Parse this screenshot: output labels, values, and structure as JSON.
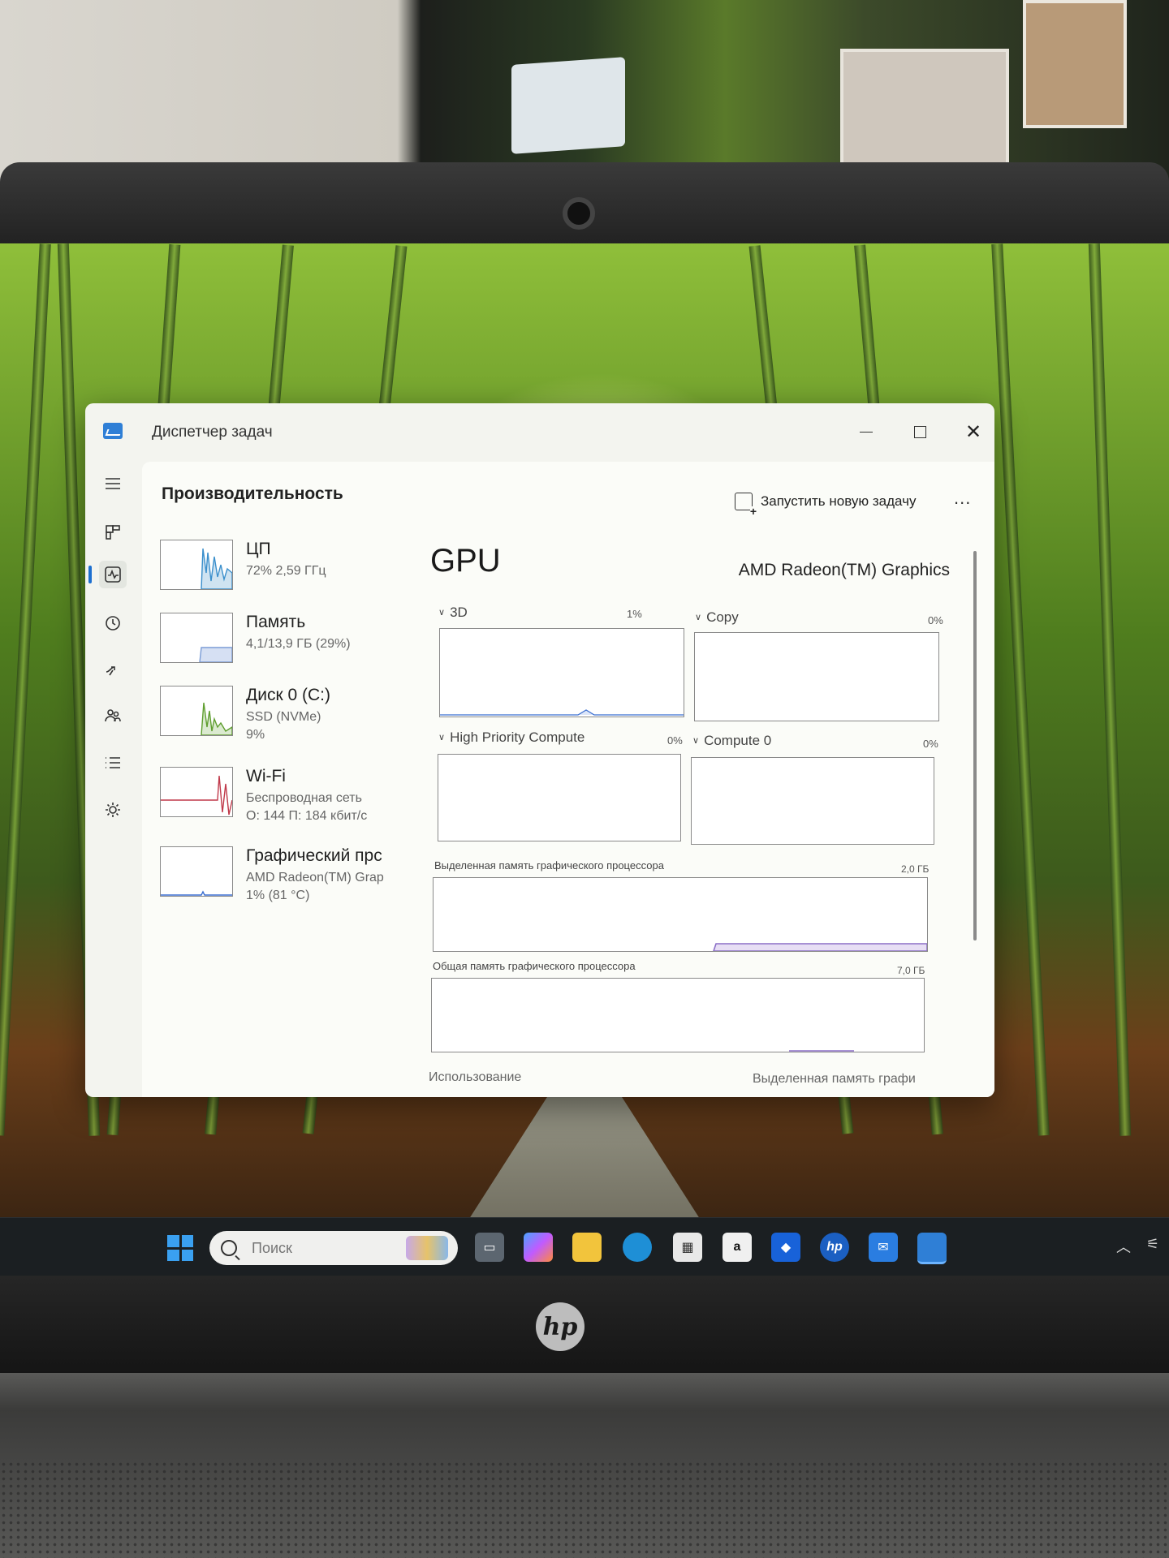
{
  "window": {
    "title": "Диспетчер задач",
    "page_title": "Производительность",
    "run_new_task": "Запустить новую задачу",
    "more": "..."
  },
  "sidebar": {
    "items": [
      {
        "name": "hamburger",
        "icon": "menu-icon"
      },
      {
        "name": "processes",
        "icon": "processes-icon"
      },
      {
        "name": "performance",
        "icon": "performance-icon",
        "active": true
      },
      {
        "name": "app-history",
        "icon": "history-icon"
      },
      {
        "name": "startup",
        "icon": "startup-icon"
      },
      {
        "name": "users",
        "icon": "users-icon"
      },
      {
        "name": "details",
        "icon": "details-icon"
      },
      {
        "name": "services",
        "icon": "services-icon"
      },
      {
        "name": "settings",
        "icon": "settings-icon"
      }
    ]
  },
  "devices": [
    {
      "name": "ЦП",
      "line1": "72% 2,59 ГГц",
      "line2": "",
      "color": "#3b8fcc"
    },
    {
      "name": "Память",
      "line1": "4,1/13,9 ГБ (29%)",
      "line2": "",
      "color": "#7a9cd6"
    },
    {
      "name": "Диск 0 (C:)",
      "line1": "SSD (NVMe)",
      "line2": "9%",
      "color": "#5f9e2f"
    },
    {
      "name": "Wi-Fi",
      "line1": "Беспроводная сеть",
      "line2": "О: 144 П: 184 кбит/с",
      "color": "#c0394a"
    },
    {
      "name": "Графический прс",
      "line1": "AMD Radeon(TM) Grap",
      "line2": "1% (81 °C)",
      "color": "#3b6fd0"
    }
  ],
  "gpu": {
    "title": "GPU",
    "model": "AMD Radeon(TM) Graphics",
    "engines": [
      {
        "label": "3D",
        "pct": "1%"
      },
      {
        "label": "Copy",
        "pct": "0%"
      },
      {
        "label": "High Priority Compute",
        "pct": "0%"
      },
      {
        "label": "Compute 0",
        "pct": "0%"
      }
    ],
    "dedicated_label": "Выделенная память графического процессора",
    "dedicated_value": "2,0 ГБ",
    "shared_label": "Общая память графического процессора",
    "shared_value": "7,0 ГБ",
    "bottom_left": "Использование",
    "bottom_right": "Выделенная память графи"
  },
  "taskbar": {
    "search_placeholder": "Поиск",
    "apps": [
      "task-view-icon",
      "copilot-icon",
      "file-explorer-icon",
      "edge-icon",
      "store-icon",
      "amazon-icon",
      "dropbox-icon",
      "hp-icon",
      "mail-icon",
      "task-manager-icon"
    ]
  },
  "colors": {
    "accent": "#1c6fd0",
    "window_bg": "#f3f4ef",
    "taskbar_bg": "#1b1f22"
  }
}
